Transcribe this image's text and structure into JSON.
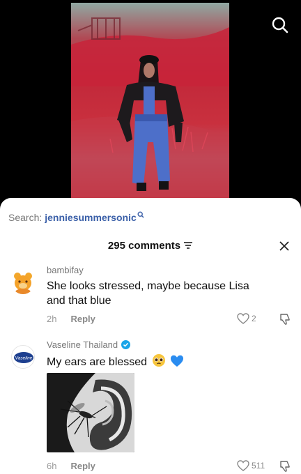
{
  "video": {
    "colors": {
      "sky": "#8fa9a3",
      "red": "#c1283a",
      "jeans": "#4d6fc9"
    }
  },
  "search": {
    "prefix": "Search:",
    "keyword": "jenniesummersonic",
    "keyword_color": "#3a5fa8"
  },
  "comments_header": {
    "count_label": "295 comments"
  },
  "comments": [
    {
      "username": "bambifay",
      "text": "She looks stressed, maybe because Lisa and that blue",
      "time": "2h",
      "reply_label": "Reply",
      "likes": "2",
      "avatar_icon": "orange-bear-avatar"
    },
    {
      "username": "Vaseline Thailand",
      "verified": true,
      "text": "My ears are blessed",
      "emojis": [
        "pleading-face-emoji",
        "blue-heart-emoji"
      ],
      "has_image": true,
      "time": "6h",
      "reply_label": "Reply",
      "likes": "511",
      "avatar_label": "Vaseline"
    }
  ]
}
